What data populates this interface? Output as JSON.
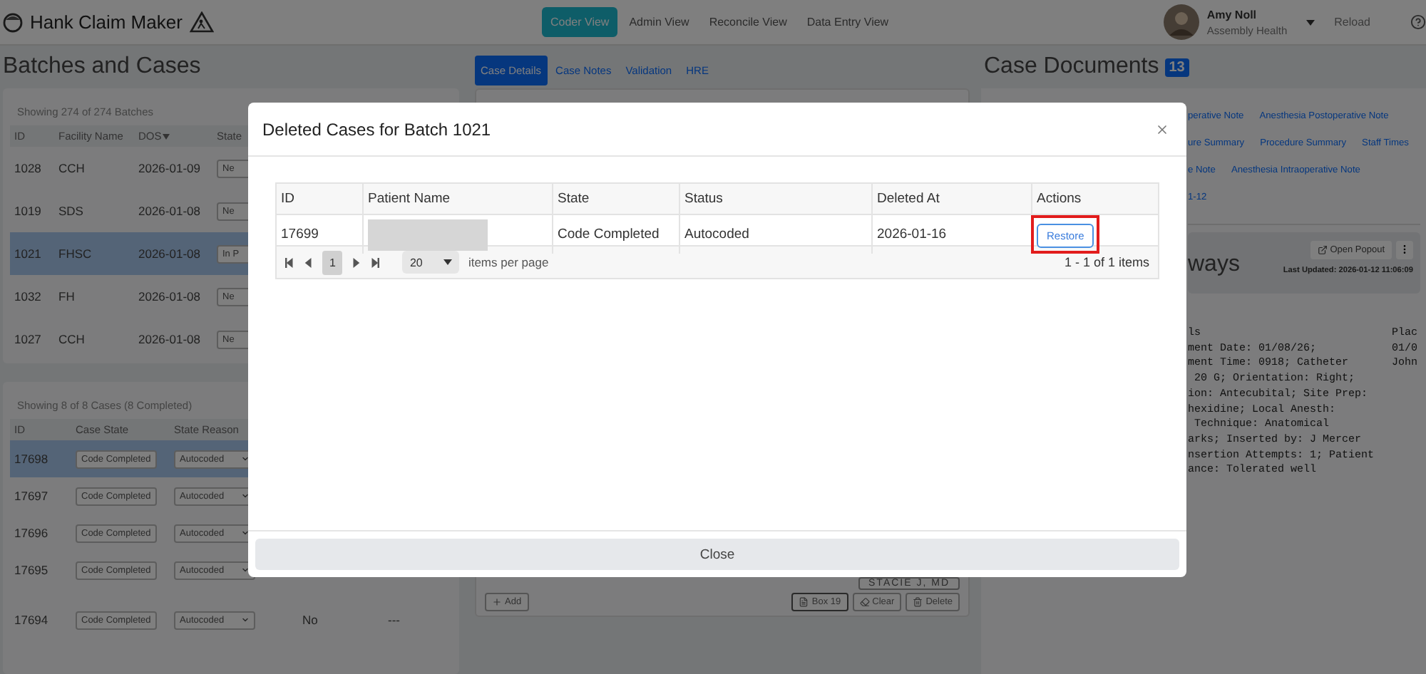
{
  "header": {
    "app_title": "Hank Claim Maker",
    "nav": [
      {
        "label": "Coder View",
        "selected": true
      },
      {
        "label": "Admin View",
        "selected": false
      },
      {
        "label": "Reconcile View",
        "selected": false
      },
      {
        "label": "Data Entry View",
        "selected": false
      }
    ],
    "user": {
      "name": "Amy Noll",
      "org": "Assembly Health"
    },
    "reload": "Reload"
  },
  "left": {
    "title": "Batches and Cases",
    "batches": {
      "summary": "Showing 274 of 274 Batches",
      "columns": [
        {
          "label": "ID",
          "sorted": false
        },
        {
          "label": "Facility Name",
          "sorted": false
        },
        {
          "label": "DOS",
          "sorted": true
        },
        {
          "label": "State",
          "sorted": false
        }
      ],
      "rows": [
        {
          "id": "1028",
          "facility": "CCH",
          "dos": "2026-01-09",
          "state": "Ne",
          "selected": false
        },
        {
          "id": "1019",
          "facility": "SDS",
          "dos": "2026-01-08",
          "state": "Ne",
          "selected": false
        },
        {
          "id": "1021",
          "facility": "FHSC",
          "dos": "2026-01-08",
          "state": "In P",
          "selected": true
        },
        {
          "id": "1032",
          "facility": "FH",
          "dos": "2026-01-08",
          "state": "Ne",
          "selected": false
        },
        {
          "id": "1027",
          "facility": "CCH",
          "dos": "2026-01-08",
          "state": "Ne",
          "selected": false
        }
      ]
    },
    "cases": {
      "summary": "Showing 8 of 8 Cases (8 Completed)",
      "columns": [
        "ID",
        "Case State",
        "State Reason"
      ],
      "rows": [
        {
          "id": "17698",
          "case_state": "Code Completed",
          "reason": "Autocoded",
          "selected": true
        },
        {
          "id": "17697",
          "case_state": "Code Completed",
          "reason": "Autocoded",
          "selected": false
        },
        {
          "id": "17696",
          "case_state": "Code Completed",
          "reason": "Autocoded",
          "selected": false
        },
        {
          "id": "17695",
          "case_state": "Code Completed",
          "reason": "Autocoded",
          "selected": false
        },
        {
          "id": "17694",
          "case_state": "Code Completed",
          "reason": "Autocoded",
          "selected": false,
          "column_4": "No",
          "column_5": "---"
        }
      ]
    }
  },
  "middle": {
    "tabs": [
      {
        "label": "Case Details",
        "selected": true
      },
      {
        "label": "Case Notes",
        "selected": false
      },
      {
        "label": "Validation",
        "selected": false
      },
      {
        "label": "HRE",
        "selected": false
      }
    ],
    "physician": "STACIE J, MD",
    "buttons": [
      {
        "label": "Add",
        "kind": "add"
      },
      {
        "label": "Box 19",
        "kind": "file"
      },
      {
        "label": "Clear",
        "kind": "clear"
      },
      {
        "label": "Delete",
        "kind": "delete"
      }
    ]
  },
  "right": {
    "title": "Case Documents",
    "count": "13",
    "link_rows": [
      [
        "perative Note",
        "Anesthesia Postoperative Note"
      ],
      [
        "ure Summary",
        "Procedure Summary",
        "Staff Times"
      ],
      [
        "e Note",
        "Anesthesia Intraoperative Note"
      ],
      [
        "1-12"
      ]
    ],
    "document": {
      "title": "ways",
      "popout": "Open Popout",
      "last_updated": "Last Updated: 2026-01-12 11:06:09",
      "text_lines": [
        "ls",
        "ment Date: 01/08/26;",
        "ment Time: 0918; Catheter",
        " 20 G; Orientation: Right;",
        "ion: Antecubital; Site Prep:",
        "hexidine; Local Anesth:",
        " Technique: Anatomical",
        "arks; Inserted by: J Mercer",
        "nsertion Attempts: 1; Patient",
        "ance: Tolerated well"
      ],
      "side_lines": [
        "Plac",
        "01/0",
        "John"
      ]
    }
  },
  "modal": {
    "title": "Deleted Cases for Batch 1021",
    "columns": [
      "ID",
      "Patient Name",
      "State",
      "Status",
      "Deleted At",
      "Actions"
    ],
    "rows": [
      {
        "id": "17699",
        "patient_redacted": true,
        "state": "Code Completed",
        "status": "Autocoded",
        "deleted_at": "2026-01-16",
        "action": {
          "label": "Restore",
          "highlighted": true
        }
      }
    ],
    "pager": {
      "page": "1",
      "page_size": "20",
      "page_size_label": "items per page",
      "range": "1 - 1 of 1 items"
    },
    "close": "Close"
  }
}
